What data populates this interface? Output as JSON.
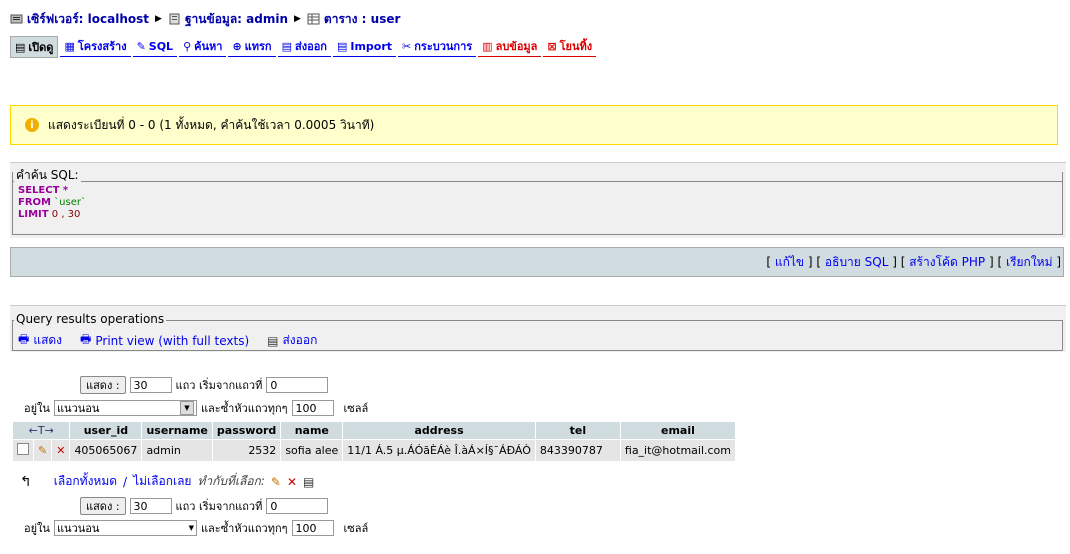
{
  "breadcrumb": {
    "server": "เซิร์ฟเวอร์: localhost",
    "database": "ฐานข้อมูล: admin",
    "table": "ตาราง : user"
  },
  "tabs": [
    {
      "label": "เปิดดู",
      "icon": "browse-icon"
    },
    {
      "label": "โครงสร้าง",
      "icon": "structure-icon"
    },
    {
      "label": "SQL",
      "icon": "sql-icon"
    },
    {
      "label": "ค้นหา",
      "icon": "search-icon"
    },
    {
      "label": "แทรก",
      "icon": "insert-icon"
    },
    {
      "label": "ส่งออก",
      "icon": "export-icon"
    },
    {
      "label": "Import",
      "icon": "import-icon"
    },
    {
      "label": "กระบวนการ",
      "icon": "operations-icon"
    },
    {
      "label": "ลบข้อมูล",
      "icon": "empty-icon"
    },
    {
      "label": "โยนทิ้ง",
      "icon": "drop-icon"
    }
  ],
  "notice": "แสดงระเบียนที่ 0 - 0 (1 ทั้งหมด, คำค้นใช้เวลา 0.0005 วินาที)",
  "sql": {
    "legend": "คำค้น SQL:",
    "select_kw": "SELECT",
    "select_rest": " *",
    "from_kw": "FROM",
    "from_rest": " `user`",
    "limit_kw": "LIMIT",
    "limit_rest": " 0 , 30",
    "links": {
      "edit": "แก้ไข",
      "explain": "อธิบาย SQL",
      "php": "สร้างโค้ด PHP",
      "refresh": "เรียกใหม่"
    }
  },
  "qro": {
    "legend": "Query results operations",
    "show": "แสดง",
    "print_full": "Print view (with full texts)",
    "export": "ส่งออก"
  },
  "nav": {
    "show_button": "แสดง :",
    "rows": "30",
    "rows_label": "แถว เริ่มจากแถวที่",
    "start": "0",
    "in_label": "อยู่ใน",
    "mode": "แนวนอน",
    "repeat_label": "และซ้ำหัวแถวทุกๆ",
    "repeat": "100",
    "cells": "เซลล์"
  },
  "table": {
    "arrows": "←T→",
    "headers": [
      "user_id",
      "username",
      "password",
      "name",
      "address",
      "tel",
      "email"
    ],
    "rows": [
      {
        "user_id": "405065067",
        "username": "admin",
        "password": "2532",
        "name": "sofia alee",
        "address": "11/1 Á.5 µ.ÁÓãÈÁè Î.àÁ×Í§¯ÁÐÁÒ",
        "tel": "843390787",
        "email": "fia_it@hotmail.com"
      }
    ]
  },
  "checkall": {
    "check": "เลือกทั้งหมด",
    "sep": " / ",
    "uncheck": "ไม่เลือกเลย",
    "with_selected": "ทำกับที่เลือก:"
  }
}
